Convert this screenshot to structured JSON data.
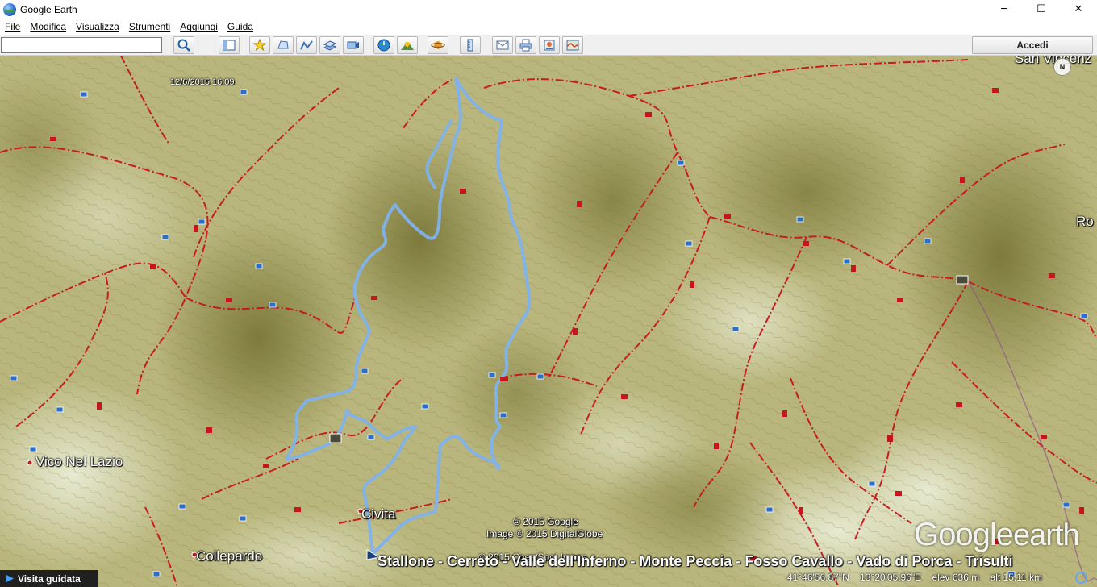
{
  "window": {
    "title": "Google Earth",
    "controls": {
      "minimize": "─",
      "maximize": "☐",
      "close": "✕"
    }
  },
  "menu": {
    "items": [
      "File",
      "Modifica",
      "Visualizza",
      "Strumenti",
      "Aggiungi",
      "Guida"
    ]
  },
  "toolbar": {
    "search_value": "",
    "signin_label": "Accedi",
    "buttons": [
      "search-icon",
      "sidebar-icon",
      "placemark-icon",
      "polygon-icon",
      "path-icon",
      "overlay-icon",
      "tour-icon",
      "historical-imagery-icon",
      "sunlight-icon",
      "planet-icon",
      "ruler-icon",
      "email-icon",
      "print-icon",
      "save-image-icon",
      "maps-icon"
    ]
  },
  "map": {
    "timestamp": "12/6/2015  16:09",
    "places": {
      "vico": "Vico Nel Lazio",
      "collepardo": "Collepardo",
      "civita": "Civita",
      "san_vincenzo": "San Vincenz",
      "ro": "Ro"
    },
    "copyright": [
      "© 2015 Google",
      "Image © 2015 DigitalGlobe",
      "© 2015 Cnes/Spot Image"
    ],
    "tour_name": "Stallone - Cerreto - Valle dell'Inferno - Monte Peccia - Fosso Cavallo - Vado di Porca - Trisulti",
    "logo": {
      "google": "Google",
      "earth": "earth"
    },
    "compass_label": "N",
    "track_color": "#7fb2ec",
    "trail_color": "#c8141e"
  },
  "statusbar": {
    "guided_tour": "Visita guidata",
    "lat": "41°46'56.87\"N",
    "lon": "13°20'05.96\"E",
    "elev": "elev   636 m",
    "alt": "alt  15.11 km"
  }
}
